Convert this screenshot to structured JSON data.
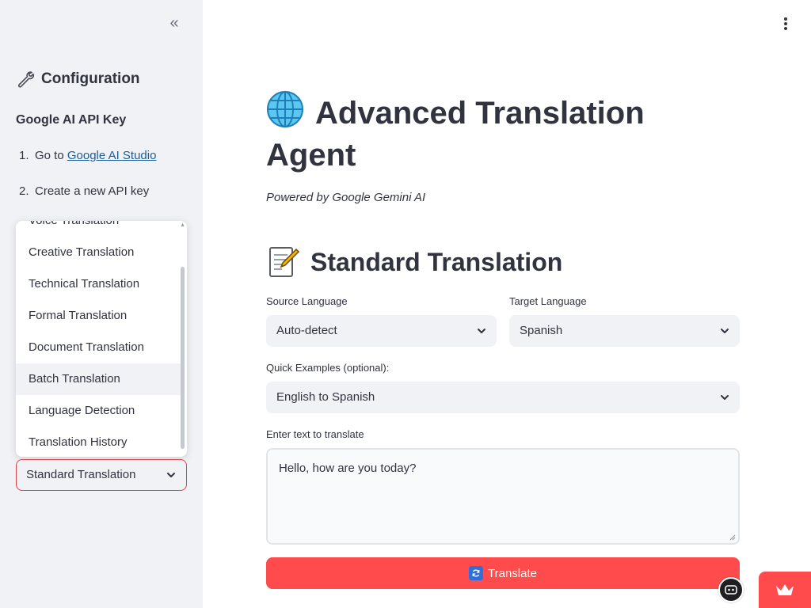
{
  "sidebar": {
    "collapse_glyph": "«",
    "title": "Configuration",
    "title_icon": "wrench-icon",
    "api_heading": "Google AI API Key",
    "steps": [
      {
        "num": "1.",
        "prefix": "Go to ",
        "link": "Google AI Studio"
      },
      {
        "num": "2.",
        "text": "Create a new API key"
      }
    ],
    "dropdown_options": [
      "Voice Translation",
      "Creative Translation",
      "Technical Translation",
      "Formal Translation",
      "Document Translation",
      "Batch Translation",
      "Language Detection",
      "Translation History"
    ],
    "hovered_option": "Batch Translation",
    "mode_selected": "Standard Translation"
  },
  "main": {
    "title": "Advanced Translation Agent",
    "title_icon": "globe-icon",
    "subtitle": "Powered by Google Gemini AI",
    "section_title": "Standard Translation",
    "section_icon": "memo-icon",
    "source_label": "Source Language",
    "source_value": "Auto-detect",
    "target_label": "Target Language",
    "target_value": "Spanish",
    "examples_label": "Quick Examples (optional):",
    "examples_value": "English to Spanish",
    "input_label": "Enter text to translate",
    "input_value": "Hello, how are you today?",
    "translate_label": "Translate"
  },
  "colors": {
    "accent": "#ff4b4b",
    "sidebar_bg": "#f0f2f6",
    "link": "#1c5c99",
    "focus_border": "#e0414d"
  }
}
